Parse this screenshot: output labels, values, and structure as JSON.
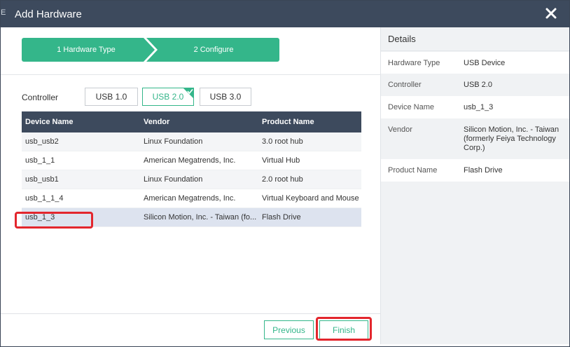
{
  "dialog": {
    "title": "Add Hardware",
    "edge_glyph": "E"
  },
  "wizard": {
    "steps": [
      {
        "label": "1 Hardware Type"
      },
      {
        "label": "2 Configure"
      }
    ]
  },
  "controller": {
    "label": "Controller",
    "options": [
      "USB 1.0",
      "USB 2.0",
      "USB 3.0"
    ],
    "selected": "USB 2.0"
  },
  "table": {
    "columns": [
      "Device Name",
      "Vendor",
      "Product Name"
    ],
    "rows": [
      {
        "device": "usb_usb2",
        "vendor": "Linux Foundation",
        "product": "3.0 root hub"
      },
      {
        "device": "usb_1_1",
        "vendor": "American Megatrends, Inc.",
        "product": "Virtual Hub"
      },
      {
        "device": "usb_usb1",
        "vendor": "Linux Foundation",
        "product": "2.0 root hub"
      },
      {
        "device": "usb_1_1_4",
        "vendor": "American Megatrends, Inc.",
        "product": "Virtual Keyboard and Mouse"
      },
      {
        "device": "usb_1_3",
        "vendor": "Silicon Motion, Inc. - Taiwan (fo...",
        "product": "Flash Drive"
      }
    ],
    "selected_row": 4
  },
  "footer": {
    "previous_label": "Previous",
    "finish_label": "Finish"
  },
  "details": {
    "heading": "Details",
    "items": [
      {
        "key": "Hardware Type",
        "value": "USB Device"
      },
      {
        "key": "Controller",
        "value": "USB 2.0"
      },
      {
        "key": "Device Name",
        "value": "usb_1_3"
      },
      {
        "key": "Vendor",
        "value": "Silicon Motion, Inc. - Taiwan (formerly Feiya Technology Corp.)"
      },
      {
        "key": "Product Name",
        "value": "Flash Drive"
      }
    ]
  },
  "colors": {
    "accent": "#34b68a",
    "titlebar": "#3d4a5d",
    "highlight": "#e3262d"
  }
}
